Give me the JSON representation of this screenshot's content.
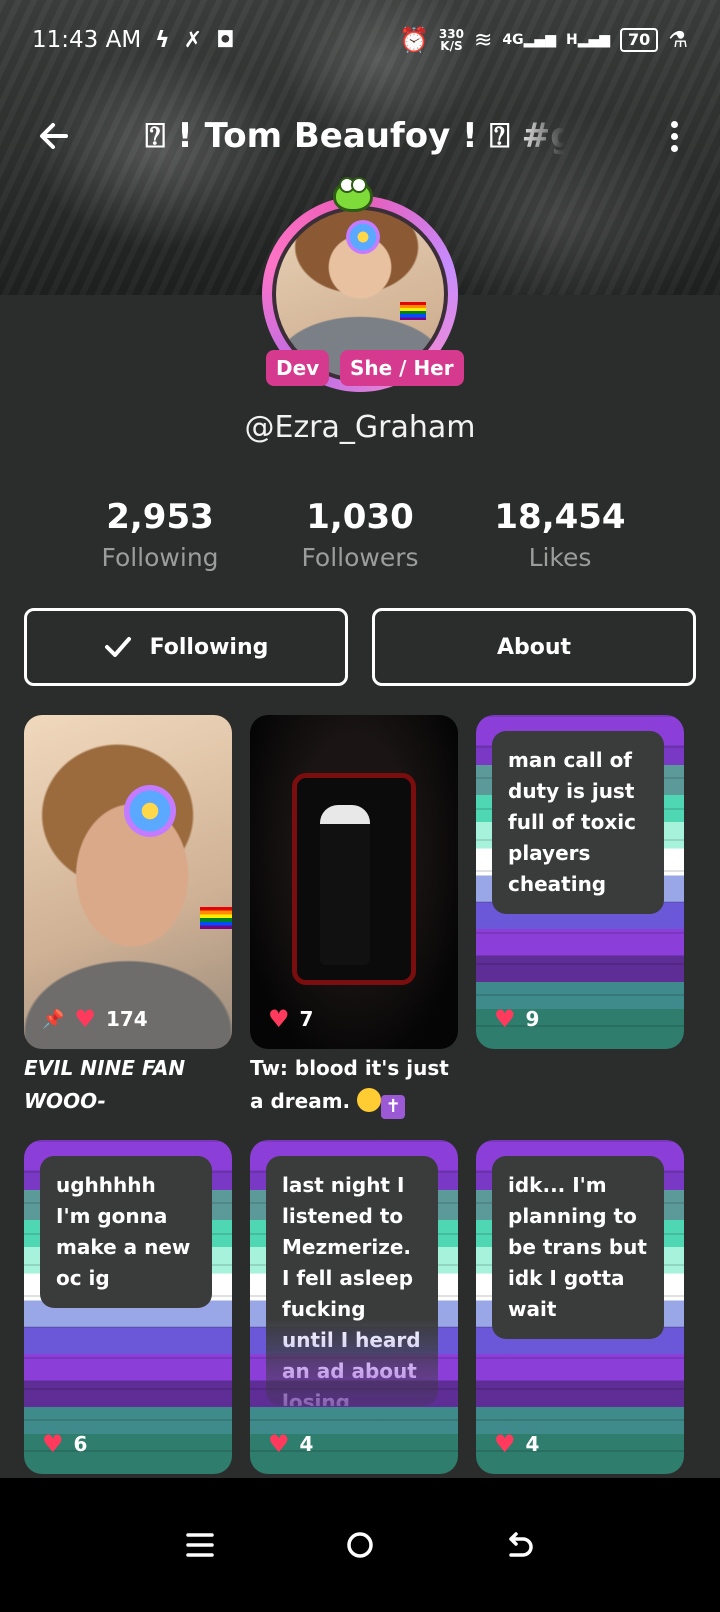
{
  "status_bar": {
    "time": "11:43 AM",
    "net_speed_value": "330",
    "net_speed_unit": "K/S",
    "network": "4G",
    "network_2": "H",
    "battery": "70"
  },
  "header": {
    "title": "⍰ ! Tom Beaufoy ! ⍰ #gjf"
  },
  "profile": {
    "badges": [
      "Dev",
      "She / Her"
    ],
    "handle": "@Ezra_Graham",
    "stats": [
      {
        "value": "2,953",
        "label": "Following"
      },
      {
        "value": "1,030",
        "label": "Followers"
      },
      {
        "value": "18,454",
        "label": "Likes"
      }
    ]
  },
  "actions": {
    "following_label": "Following",
    "about_label": "About"
  },
  "posts": [
    {
      "type": "photo",
      "likes": "174",
      "pinned": true,
      "caption": "EVIL NINE FAN WOOO-"
    },
    {
      "type": "image",
      "likes": "7",
      "caption": "Tw: blood it's just a dream."
    },
    {
      "type": "text",
      "likes": "9",
      "text": "man call of duty is just full of toxic players cheating"
    },
    {
      "type": "text",
      "likes": "6",
      "text": "ughhhhh I'm gonna make a new oc ig"
    },
    {
      "type": "text",
      "likes": "4",
      "text": "last night I listened to Mezmerize. I fell asleep fucking until I heard an ad about losing"
    },
    {
      "type": "text",
      "likes": "4",
      "text": "idk... I'm planning to be trans but idk I gotta wait"
    }
  ],
  "colors": {
    "background": "#2b2d2c",
    "like_heart": "#ff3a5c",
    "badge": "#d63a8e"
  }
}
